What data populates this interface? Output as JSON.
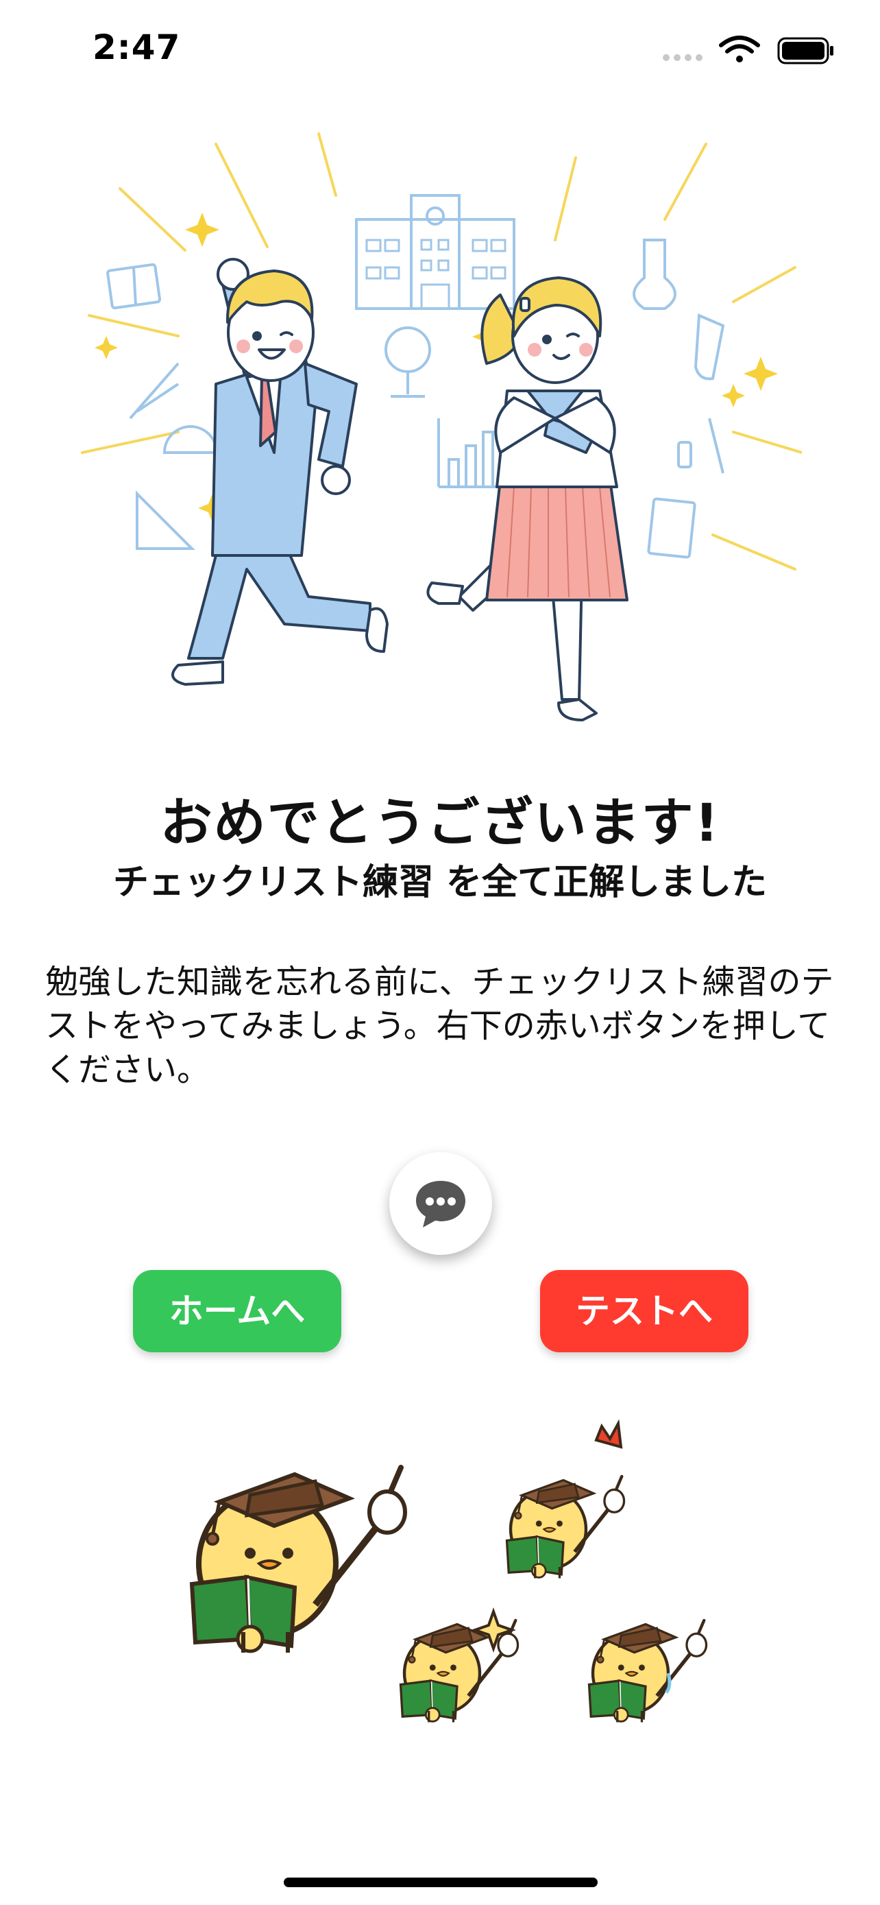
{
  "status_bar": {
    "time": "2:47",
    "icons": [
      "signal-dots-icon",
      "wifi-icon",
      "battery-icon"
    ]
  },
  "illustrations": {
    "top": "students-celebrating-illustration",
    "bottom": "graduate-chicks-illustration"
  },
  "result": {
    "title": "おめでとうございます!",
    "subtitle": "チェックリスト練習 を全て正解しました",
    "message": "勉強した知識を忘れる前に、チェックリスト練習のテストをやってみましょう。右下の赤いボタンを押してください。"
  },
  "chat_button": {
    "icon": "chat-bubble-icon"
  },
  "actions": {
    "home_label": "ホームへ",
    "test_label": "テストへ"
  },
  "colors": {
    "home_button": "#35c759",
    "test_button": "#ff3b30"
  }
}
